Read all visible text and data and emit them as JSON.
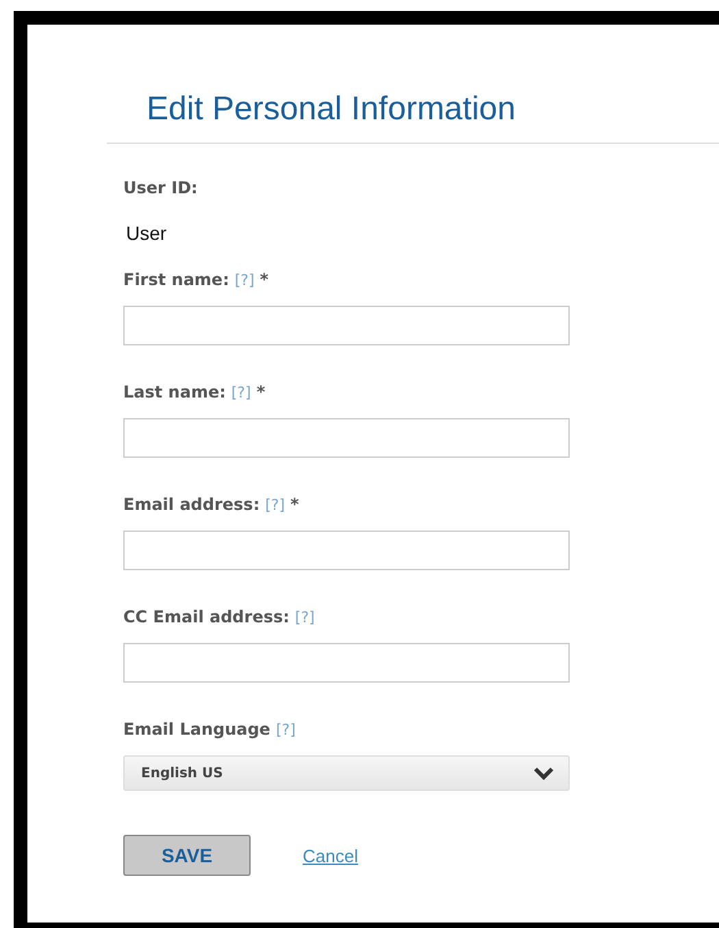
{
  "title": "Edit Personal Information",
  "user_id": {
    "label": "User ID:",
    "value": "User"
  },
  "fields": [
    {
      "kind": "text",
      "label": "First name:",
      "help": "[?]",
      "required": "*"
    },
    {
      "kind": "text",
      "label": "Last name:",
      "help": "[?]",
      "required": "*"
    },
    {
      "kind": "text",
      "label": "Email address:",
      "help": "[?]",
      "required": "*"
    },
    {
      "kind": "text",
      "label": "CC Email address:",
      "help": "[?]"
    },
    {
      "kind": "select",
      "label": "Email Language",
      "help": "[?]",
      "value": "English US"
    }
  ],
  "save_button": "SAVE",
  "cancel_link": "Cancel"
}
